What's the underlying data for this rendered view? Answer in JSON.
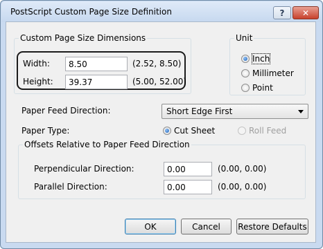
{
  "window": {
    "title": "PostScript Custom Page Size Definition",
    "help_label": "?",
    "close_label": "✕"
  },
  "dimensions": {
    "group_label": "Custom Page Size Dimensions",
    "width_label": "Width:",
    "width_value": "8.50",
    "width_range": "(2.52, 8.50)",
    "height_label": "Height:",
    "height_value": "39.37",
    "height_range": "(5.00, 52.00)"
  },
  "unit": {
    "group_label": "Unit",
    "options": [
      {
        "label": "Inch",
        "selected": true
      },
      {
        "label": "Millimeter",
        "selected": false
      },
      {
        "label": "Point",
        "selected": false
      }
    ]
  },
  "paper_feed": {
    "label": "Paper Feed Direction:",
    "value": "Short Edge First"
  },
  "paper_type": {
    "label": "Paper Type:",
    "options": [
      {
        "label": "Cut Sheet",
        "selected": true,
        "enabled": true
      },
      {
        "label": "Roll Feed",
        "selected": false,
        "enabled": false
      }
    ]
  },
  "offsets": {
    "group_label": "Offsets Relative to Paper Feed Direction",
    "perpendicular_label": "Perpendicular Direction:",
    "perpendicular_value": "0.00",
    "perpendicular_range": "(0.00, 0.00)",
    "parallel_label": "Parallel Direction:",
    "parallel_value": "0.00",
    "parallel_range": "(0.00, 0.00)"
  },
  "buttons": {
    "ok": "OK",
    "cancel": "Cancel",
    "restore_defaults": "Restore Defaults"
  }
}
